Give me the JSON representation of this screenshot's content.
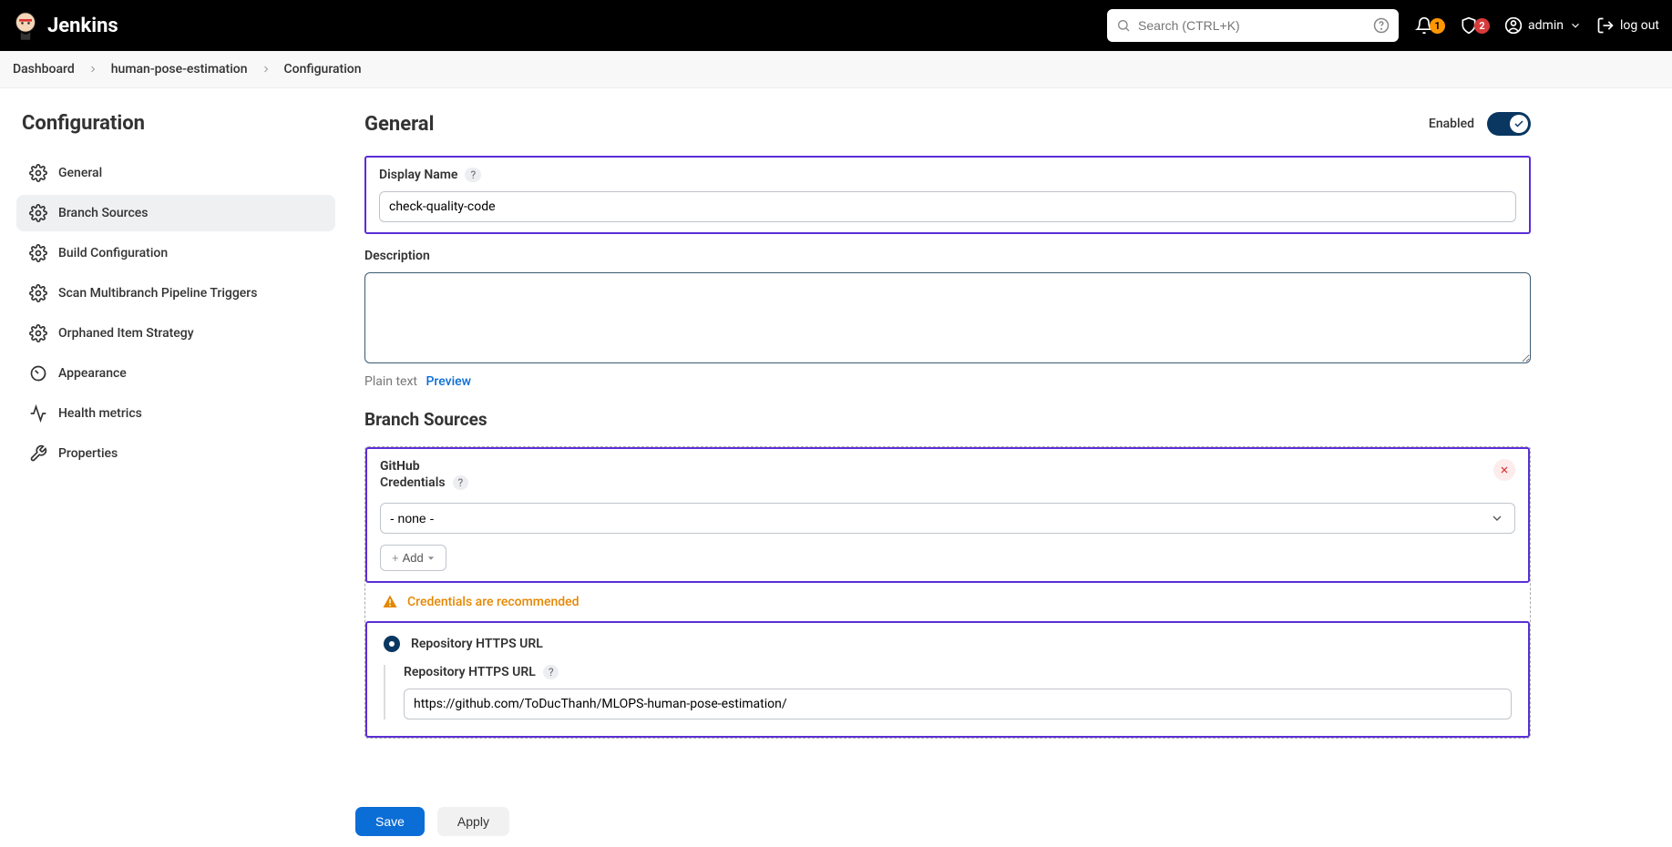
{
  "header": {
    "brand": "Jenkins",
    "search_placeholder": "Search (CTRL+K)",
    "notifications_count": "1",
    "security_count": "2",
    "user": "admin",
    "logout": "log out"
  },
  "breadcrumb": {
    "items": [
      "Dashboard",
      "human-pose-estimation",
      "Configuration"
    ]
  },
  "sidebar": {
    "title": "Configuration",
    "items": [
      {
        "label": "General",
        "active": false
      },
      {
        "label": "Branch Sources",
        "active": true
      },
      {
        "label": "Build Configuration",
        "active": false
      },
      {
        "label": "Scan Multibranch Pipeline Triggers",
        "active": false
      },
      {
        "label": "Orphaned Item Strategy",
        "active": false
      },
      {
        "label": "Appearance",
        "active": false
      },
      {
        "label": "Health metrics",
        "active": false
      },
      {
        "label": "Properties",
        "active": false
      }
    ]
  },
  "main": {
    "title": "General",
    "enabled_label": "Enabled",
    "display_name_label": "Display Name",
    "display_name_value": "check-quality-code",
    "description_label": "Description",
    "description_value": "",
    "plain_text": "Plain text",
    "preview": "Preview",
    "branch_sources_title": "Branch Sources",
    "source_name": "GitHub",
    "credentials_label": "Credentials",
    "credentials_value": "- none -",
    "add_label": "Add",
    "warning": "Credentials are recommended",
    "repo_radio_label": "Repository HTTPS URL",
    "repo_url_label": "Repository HTTPS URL",
    "repo_url_value": "https://github.com/ToDucThanh/MLOPS-human-pose-estimation/",
    "save": "Save",
    "apply": "Apply"
  }
}
